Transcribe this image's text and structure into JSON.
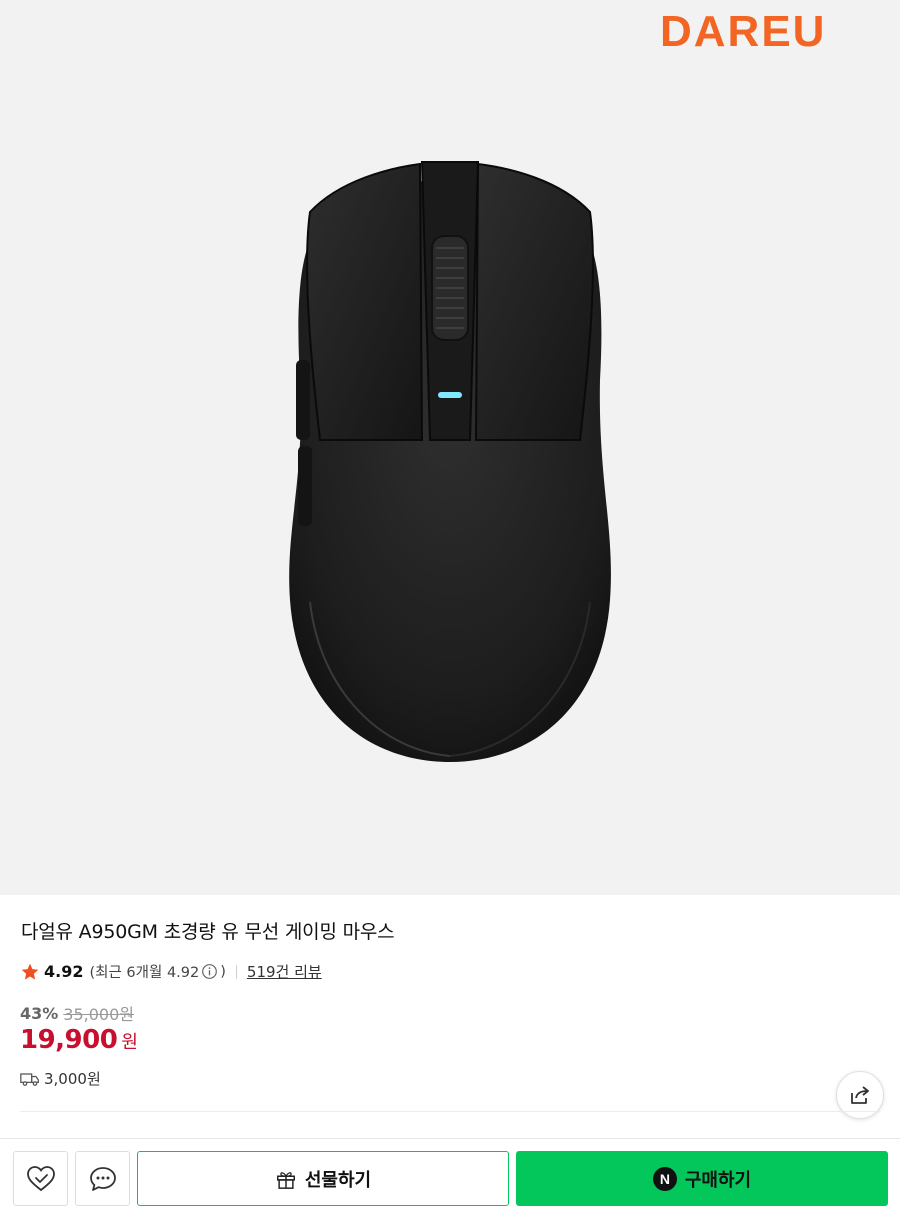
{
  "hero": {
    "brand_logo_text": "DAREU",
    "brand_color": "#f26522",
    "product_image": "black-wireless-gaming-mouse"
  },
  "product": {
    "title": "다얼유 A950GM 초경량 유 무선 게이밍 마우스",
    "rating": "4.92",
    "rating_recent": "(최근 6개월 4.92",
    "rating_recent_close": ")",
    "review_count": "519건 리뷰",
    "discount": "43%",
    "original_price": "35,000원",
    "price": "19,900",
    "price_unit": "원",
    "shipping_fee": "3,000원"
  },
  "actions": {
    "gift_label": "선물하기",
    "buy_label": "구매하기",
    "buy_badge": "N"
  },
  "colors": {
    "accent_green": "#03c75a",
    "price_red": "#c8102e",
    "star": "#f04e23"
  },
  "icons": [
    "heart-check-icon",
    "chat-icon",
    "gift-icon",
    "share-icon",
    "truck-icon",
    "star-icon",
    "info-icon"
  ]
}
